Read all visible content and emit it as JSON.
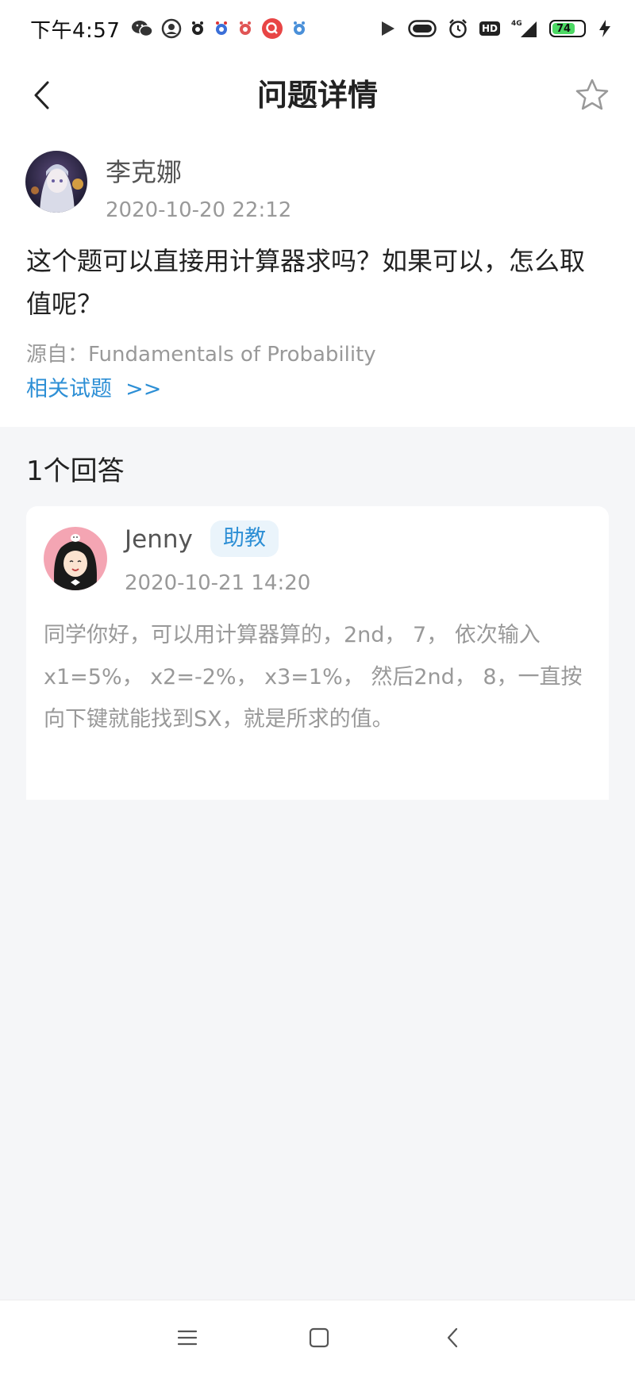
{
  "status_bar": {
    "time": "下午4:57",
    "battery_level": 74,
    "battery_text": "74",
    "hd_label": "HD",
    "network_label": "4G"
  },
  "header": {
    "title": "问题详情",
    "back_icon": "chevron-left-icon",
    "favorite_icon": "star-outline-icon"
  },
  "question": {
    "author": "李克娜",
    "time": "2020-10-20 22:12",
    "text": "这个题可以直接用计算器求吗？如果可以，怎么取值呢？",
    "source_prefix": "源自：",
    "source_name": "Fundamentals of Probability",
    "related_label": "相关试题",
    "related_arrow": ">>"
  },
  "answers": {
    "count_label": "1个回答",
    "items": [
      {
        "author": "Jenny",
        "role": "助教",
        "time": "2020-10-21 14:20",
        "text": "同学你好，可以用计算器算的，2nd， 7， 依次输入x1=5%， x2=-2%， x3=1%， 然后2nd， 8，一直按向下键就能找到SX，就是所求的值。"
      }
    ]
  },
  "colors": {
    "accent": "#2d8fd5",
    "background_gray": "#f5f6f8",
    "badge_bg": "#eaf4fb",
    "muted_text": "#999999"
  },
  "system_nav": {
    "menu_icon": "menu-icon",
    "home_icon": "home-square-icon",
    "back_icon": "back-triangle-icon"
  }
}
